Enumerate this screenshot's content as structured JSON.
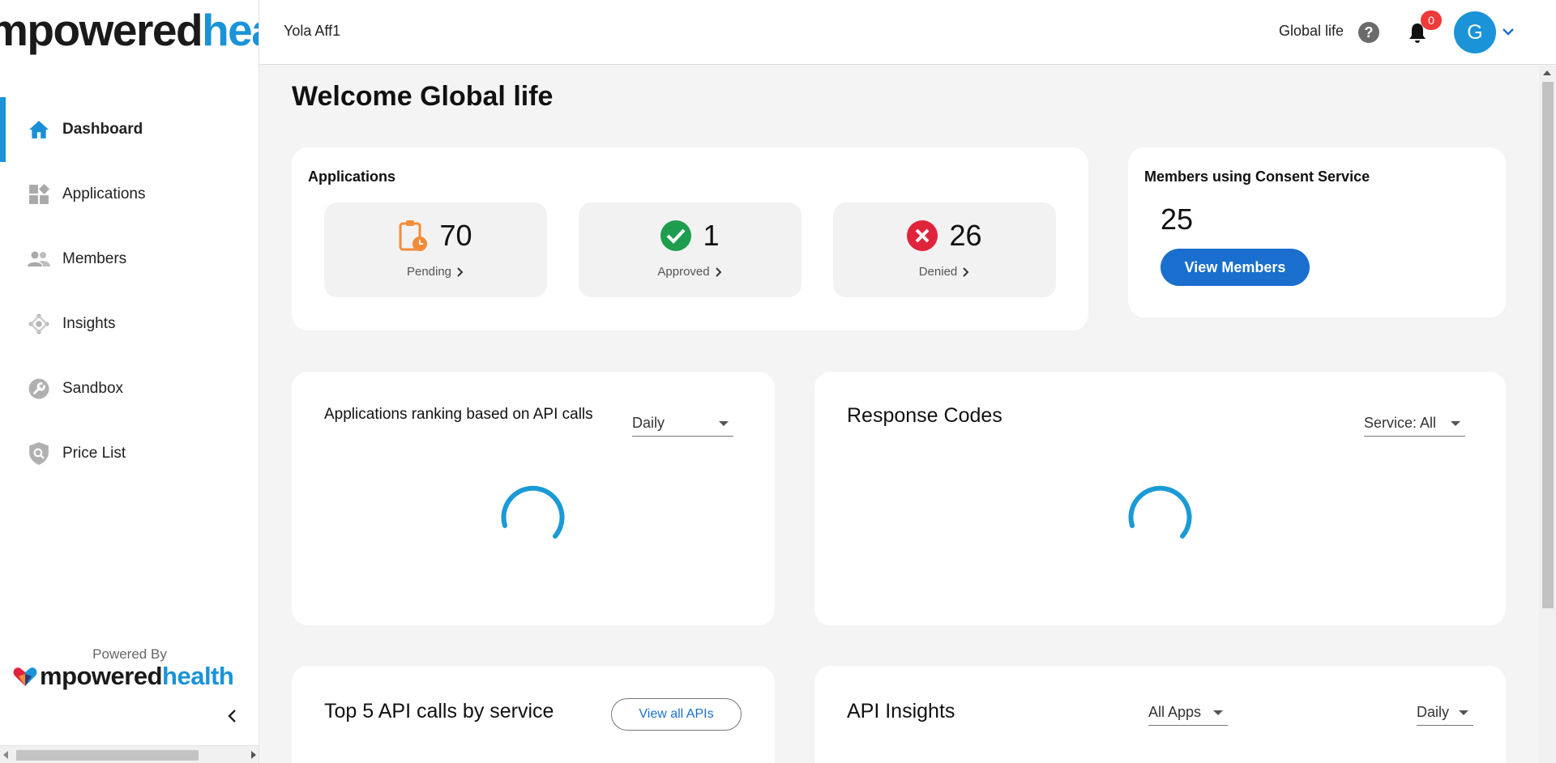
{
  "brand": {
    "word1": "mpowered",
    "word2": "health",
    "accent_color": "#1a93d8"
  },
  "sidebar": {
    "items": [
      {
        "label": "Dashboard",
        "icon": "home-icon",
        "active": true
      },
      {
        "label": "Applications",
        "icon": "widgets-icon",
        "active": false
      },
      {
        "label": "Members",
        "icon": "people-icon",
        "active": false
      },
      {
        "label": "Insights",
        "icon": "insights-icon",
        "active": false
      },
      {
        "label": "Sandbox",
        "icon": "wrench-icon",
        "active": false
      },
      {
        "label": "Price List",
        "icon": "shield-search-icon",
        "active": false
      }
    ],
    "powered_by": "Powered By"
  },
  "header": {
    "org_name": "Yola Aff1",
    "user_org": "Global life",
    "help_icon": "?",
    "notification_count": "0",
    "avatar_initial": "G"
  },
  "main": {
    "welcome": "Welcome Global life",
    "applications": {
      "title": "Applications",
      "pending": {
        "value": "70",
        "label": "Pending",
        "color": "#f28c38"
      },
      "approved": {
        "value": "1",
        "label": "Approved",
        "color": "#1f9d4e"
      },
      "denied": {
        "value": "26",
        "label": "Denied",
        "color": "#e0243c"
      }
    },
    "members": {
      "title": "Members using Consent Service",
      "count": "25",
      "button": "View Members"
    },
    "ranking": {
      "title": "Applications ranking based on API calls",
      "period": "Daily"
    },
    "response_codes": {
      "title": "Response Codes",
      "service": "Service: All"
    },
    "top5": {
      "title": "Top 5 API calls by service",
      "button": "View all APIs"
    },
    "api_insights": {
      "title": "API Insights",
      "apps": "All Apps",
      "period": "Daily"
    }
  }
}
